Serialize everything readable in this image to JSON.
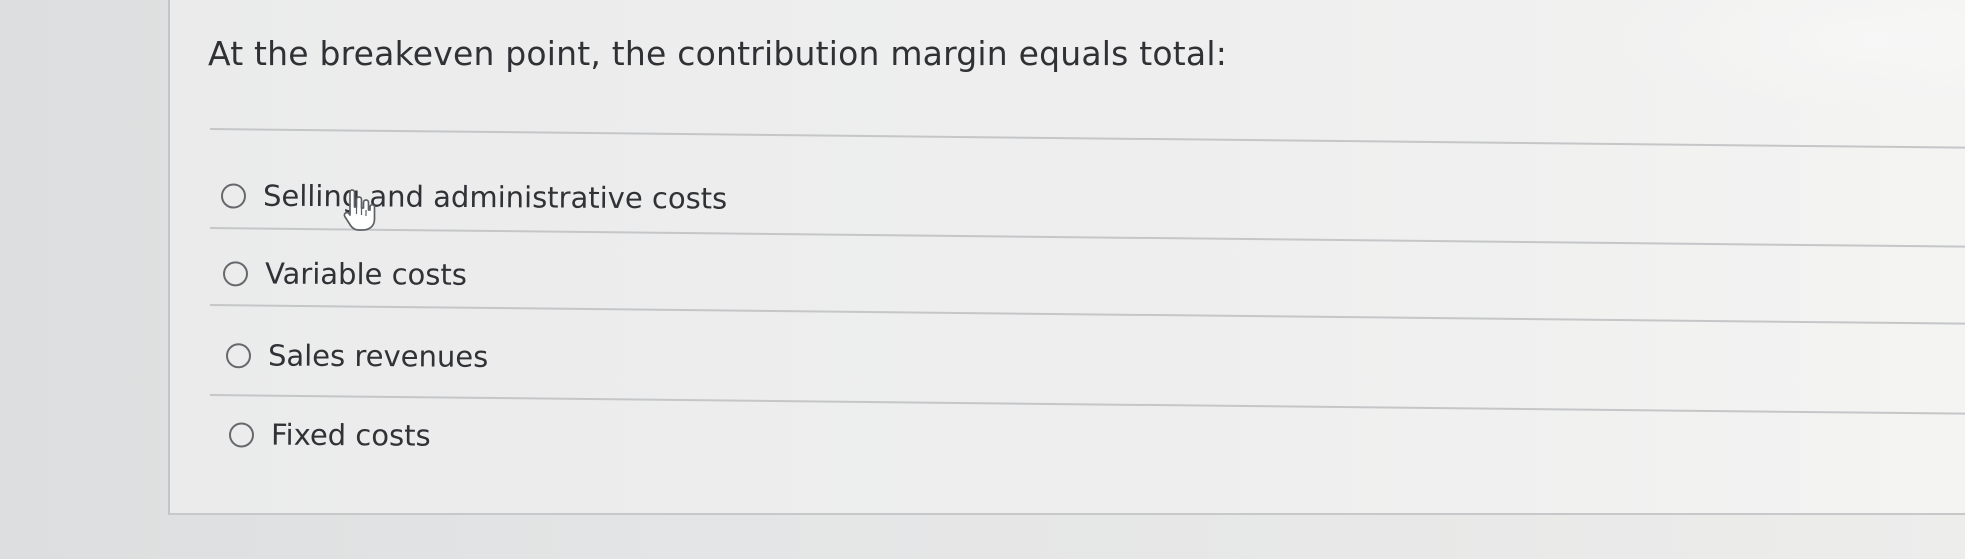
{
  "question": {
    "text": "At the breakeven point, the contribution margin equals total:"
  },
  "options": [
    {
      "label": "Selling and administrative costs"
    },
    {
      "label": "Variable costs"
    },
    {
      "label": "Sales revenues"
    },
    {
      "label": "Fixed costs"
    }
  ],
  "cursor": {
    "icon": "hand-pointer-icon"
  },
  "colors": {
    "text": "#303236",
    "radio_border": "#66686c",
    "separator": "#c4c6c8"
  }
}
